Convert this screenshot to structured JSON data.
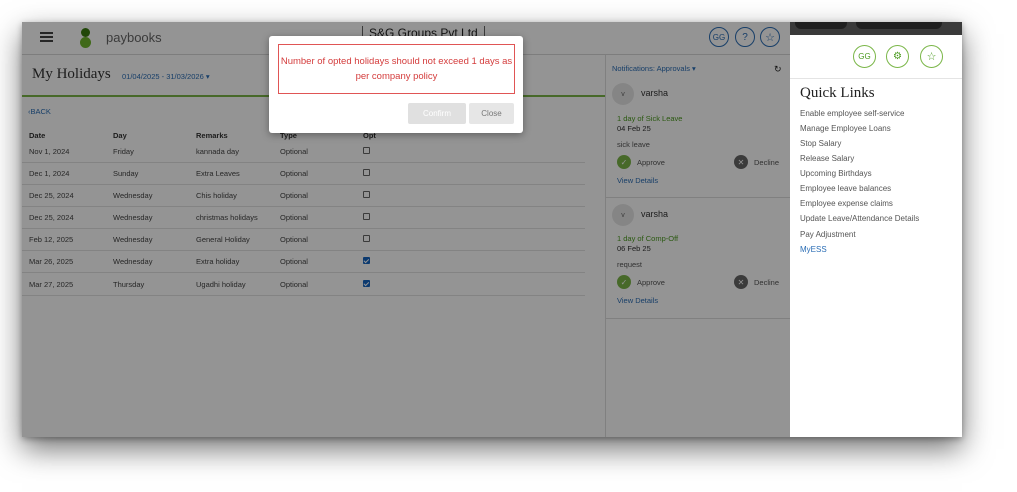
{
  "app": {
    "logo_text": "paybooks",
    "company": "S&G Groups Pvt Ltd",
    "header_buttons": [
      "GG",
      "?",
      "☆"
    ]
  },
  "page": {
    "title": "My Holidays",
    "date_range": "01/04/2025 - 31/03/2026 ▾",
    "back_label": "‹BACK",
    "columns": [
      "Date",
      "Day",
      "Remarks",
      "Type",
      "Opt"
    ],
    "rows": [
      {
        "date": "Nov 1, 2024",
        "day": "Friday",
        "remarks": "kannada day",
        "type": "Optional",
        "opted": false
      },
      {
        "date": "Dec 1, 2024",
        "day": "Sunday",
        "remarks": "Extra Leaves",
        "type": "Optional",
        "opted": false
      },
      {
        "date": "Dec 25, 2024",
        "day": "Wednesday",
        "remarks": "Chis holiday",
        "type": "Optional",
        "opted": false
      },
      {
        "date": "Dec 25, 2024",
        "day": "Wednesday",
        "remarks": "christmas holidays",
        "type": "Optional",
        "opted": false
      },
      {
        "date": "Feb 12, 2025",
        "day": "Wednesday",
        "remarks": "General Holiday",
        "type": "Optional",
        "opted": false
      },
      {
        "date": "Mar 26, 2025",
        "day": "Wednesday",
        "remarks": "Extra holiday",
        "type": "Optional",
        "opted": true
      },
      {
        "date": "Mar 27, 2025",
        "day": "Thursday",
        "remarks": "Ugadhi holiday",
        "type": "Optional",
        "opted": true
      }
    ]
  },
  "notifications": {
    "header": "Notifications:  Approvals ▾",
    "refresh_icon": "↻",
    "cards": [
      {
        "avatar": "v",
        "name": "varsha",
        "leave": "1 day of Sick Leave",
        "date": "04 Feb 25",
        "note": "sick leave",
        "approve": "Approve",
        "decline": "Decline",
        "details": "View Details"
      },
      {
        "avatar": "v",
        "name": "varsha",
        "leave": "1 day of Comp-Off",
        "date": "06 Feb 25",
        "note": "request",
        "approve": "Approve",
        "decline": "Decline",
        "details": "View Details"
      }
    ]
  },
  "modal": {
    "message": "Number of opted holidays should not exceed 1 days as per company policy",
    "confirm_label": "Confirm",
    "close_label": "Close"
  },
  "quick_links": {
    "buttons": [
      "GG",
      "⚙",
      "☆"
    ],
    "title": "Quick Links",
    "items": [
      "Enable employee self-service",
      "Manage Employee Loans",
      "Stop Salary",
      "Release Salary",
      "Upcoming Birthdays",
      "Employee leave balances",
      "Employee expense claims",
      "Update Leave/Attendance Details",
      "Pay Adjustment",
      "MyESS"
    ]
  },
  "colors": {
    "accent_green": "#7ab648",
    "link_blue": "#2a6db5",
    "error_red": "#d43c3c"
  }
}
